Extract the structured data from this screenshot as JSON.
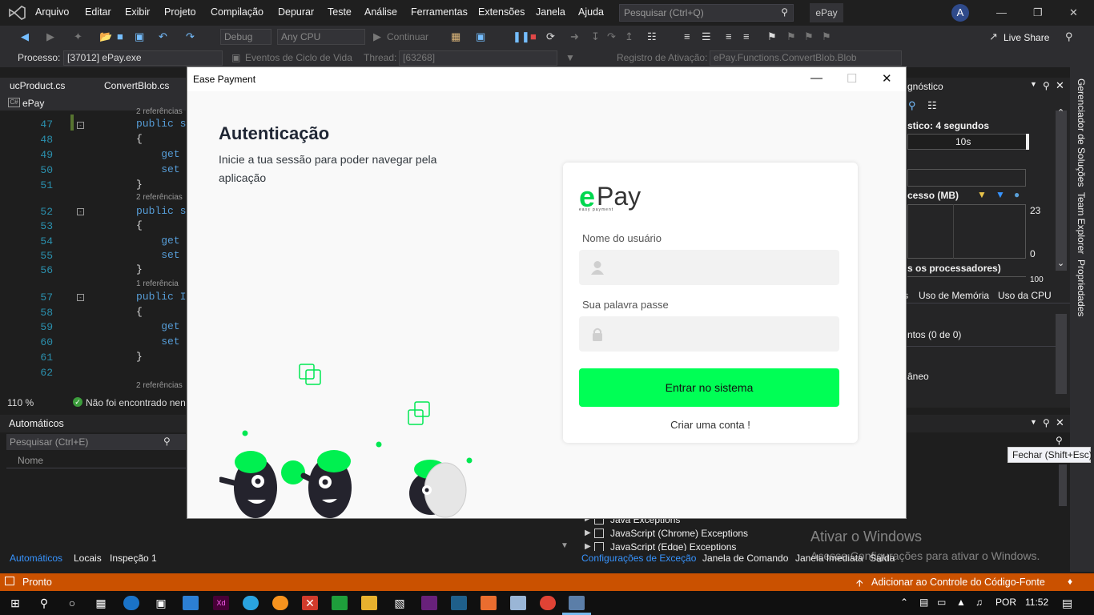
{
  "menubar": {
    "items": [
      "Arquivo",
      "Editar",
      "Exibir",
      "Projeto",
      "Compilação",
      "Depurar",
      "Teste",
      "Análise",
      "Ferramentas",
      "Extensões",
      "Janela",
      "Ajuda"
    ],
    "search_placeholder": "Pesquisar (Ctrl+Q)",
    "solution_name": "ePay",
    "avatar_letter": "A"
  },
  "toolbar": {
    "config": "Debug",
    "platform": "Any CPU",
    "continue_label": "Continuar",
    "live_share": "Live Share"
  },
  "toolbar2": {
    "process_label": "Processo:",
    "process_value": "[37012] ePay.exe",
    "lifecycle_events": "Eventos de Ciclo de Vida",
    "thread_label": "Thread:",
    "thread_value": "[63268]",
    "stack_label": "Registro de Ativação:",
    "stack_value": "ePay.Functions.ConvertBlob.Blob"
  },
  "editor": {
    "tabs": [
      "ucProduct.cs",
      "ConvertBlob.cs"
    ],
    "project": "ePay",
    "zoom": "110 %",
    "issues": "Não foi encontrado nen",
    "refs": {
      "r47": "2 referências",
      "r52": "2 referências",
      "r57": "1 referência",
      "r62": "2 referências"
    },
    "lines": [
      {
        "n": "47",
        "code": "public s"
      },
      {
        "n": "48",
        "code": "{"
      },
      {
        "n": "49",
        "code": "    get"
      },
      {
        "n": "50",
        "code": "    set"
      },
      {
        "n": "51",
        "code": "}"
      },
      {
        "n": "52",
        "code": "public s"
      },
      {
        "n": "53",
        "code": "{"
      },
      {
        "n": "54",
        "code": "    get"
      },
      {
        "n": "55",
        "code": "    set"
      },
      {
        "n": "56",
        "code": "}"
      },
      {
        "n": "57",
        "code": "public I"
      },
      {
        "n": "58",
        "code": "{"
      },
      {
        "n": "59",
        "code": "    get"
      },
      {
        "n": "60",
        "code": "    set"
      },
      {
        "n": "61",
        "code": "}"
      },
      {
        "n": "62",
        "code": ""
      }
    ]
  },
  "autos": {
    "title": "Automáticos",
    "search_placeholder": "Pesquisar (Ctrl+E)",
    "col_name": "Nome",
    "tabs": [
      "Automáticos",
      "Locais",
      "Inspeção 1"
    ]
  },
  "diagnostics": {
    "title_partial": "gnóstico",
    "session": "stico: 4 segundos",
    "time_tick": "10s",
    "memory_label": "cesso (MB)",
    "mem_max": "23",
    "mem_min": "0",
    "cpu_label": "s os processadores)",
    "cpu_max": "100",
    "tabs": [
      "s",
      "Uso de Memória",
      "Uso da CPU"
    ],
    "events": "ntos (0 de 0)",
    "item": "âneo"
  },
  "exceptions": {
    "items": [
      "Java Exceptions",
      "JavaScript (Chrome) Exceptions",
      "JavaScript (Edge) Exceptions"
    ],
    "tabs": [
      "Configurações de Exceção",
      "Janela de Comando",
      "Janela Imediata",
      "Saída"
    ]
  },
  "side_tabs": [
    "Gerenciador de Soluções",
    "Team Explorer",
    "Propriedades"
  ],
  "tooltip": "Fechar (Shift+Esc)",
  "watermark": {
    "line1": "Ativar o Windows",
    "line2": "Acesse Configurações para ativar o Windows."
  },
  "statusbar": {
    "state": "Pronto",
    "source_control": "Adicionar ao Controle do Código-Fonte"
  },
  "taskbar": {
    "lang": "POR",
    "time": "11:52"
  },
  "dialog": {
    "window_title": "Ease Payment",
    "heading": "Autenticação",
    "subtitle": "Inicie a tua sessão para poder navegar pela aplicação",
    "logo_e": "e",
    "logo_pay": "Pay",
    "logo_tagline": "easy payment",
    "username_label": "Nome do usuário",
    "password_label": "Sua palavra passe",
    "login_button": "Entrar no sistema",
    "create_account": "Criar uma conta !",
    "accent_color": "#00ff55"
  }
}
